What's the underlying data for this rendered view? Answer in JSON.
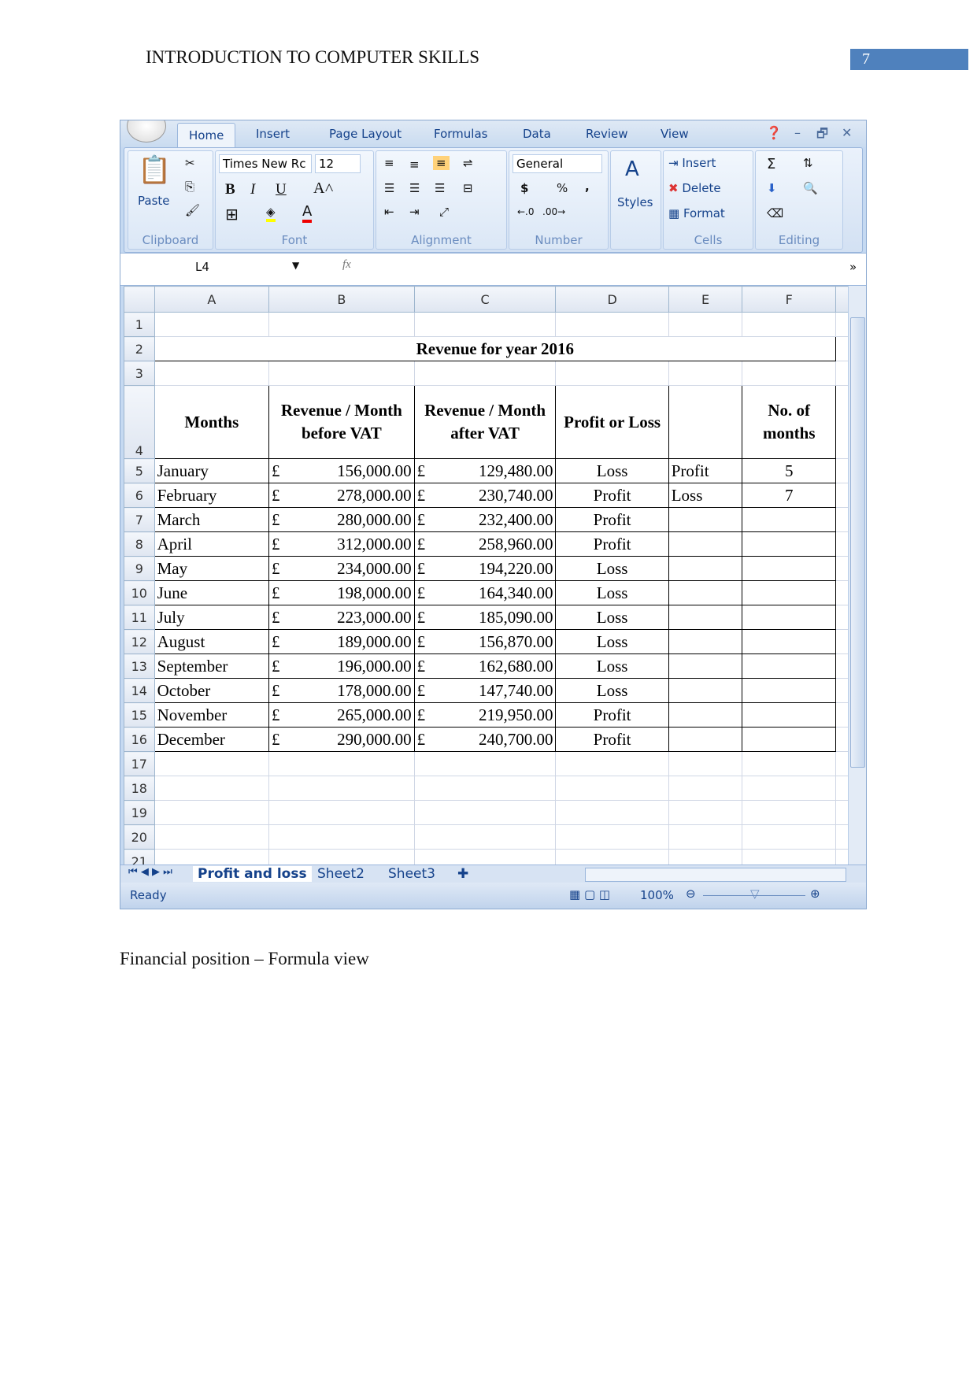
{
  "header": {
    "title": "INTRODUCTION TO COMPUTER SKILLS",
    "page_number": "7",
    "page_number_color": "#4f81bd"
  },
  "ribbon": {
    "tabs": [
      "Home",
      "Insert",
      "Page Layout",
      "Formulas",
      "Data",
      "Review",
      "View"
    ],
    "active_tab": "Home",
    "groups": [
      "Clipboard",
      "Font",
      "Alignment",
      "Number",
      "Styles",
      "Cells",
      "Editing"
    ],
    "paste": "Paste",
    "font_name": "Times New Rc",
    "font_size": "12",
    "number_format": "General",
    "styles": "Styles",
    "insert": "Insert",
    "delete": "Delete",
    "format": "Format",
    "bold": "B",
    "italic": "I",
    "underline": "U",
    "currency": "$",
    "percent": "%",
    "comma": ","
  },
  "formula_bar": {
    "name_box": "L4",
    "fx": "fx",
    "value": ""
  },
  "sheet": {
    "columns": [
      "A",
      "B",
      "C",
      "D",
      "E",
      "F"
    ],
    "title": "Revenue for year 2016",
    "headers": [
      "Months",
      "Revenue / Month before VAT",
      "Revenue / Month after VAT",
      "Profit or Loss",
      "",
      "No. of months"
    ],
    "currency_symbol": "£",
    "rows": [
      {
        "month": "January",
        "before": "156,000.00",
        "after": "129,480.00",
        "pl": "Loss",
        "e": "Profit",
        "f": "5"
      },
      {
        "month": "February",
        "before": "278,000.00",
        "after": "230,740.00",
        "pl": "Profit",
        "e": "Loss",
        "f": "7"
      },
      {
        "month": "March",
        "before": "280,000.00",
        "after": "232,400.00",
        "pl": "Profit",
        "e": "",
        "f": ""
      },
      {
        "month": "April",
        "before": "312,000.00",
        "after": "258,960.00",
        "pl": "Profit",
        "e": "",
        "f": ""
      },
      {
        "month": "May",
        "before": "234,000.00",
        "after": "194,220.00",
        "pl": "Loss",
        "e": "",
        "f": ""
      },
      {
        "month": "June",
        "before": "198,000.00",
        "after": "164,340.00",
        "pl": "Loss",
        "e": "",
        "f": ""
      },
      {
        "month": "July",
        "before": "223,000.00",
        "after": "185,090.00",
        "pl": "Loss",
        "e": "",
        "f": ""
      },
      {
        "month": "August",
        "before": "189,000.00",
        "after": "156,870.00",
        "pl": "Loss",
        "e": "",
        "f": ""
      },
      {
        "month": "September",
        "before": "196,000.00",
        "after": "162,680.00",
        "pl": "Loss",
        "e": "",
        "f": ""
      },
      {
        "month": "October",
        "before": "178,000.00",
        "after": "147,740.00",
        "pl": "Loss",
        "e": "",
        "f": ""
      },
      {
        "month": "November",
        "before": "265,000.00",
        "after": "219,950.00",
        "pl": "Profit",
        "e": "",
        "f": ""
      },
      {
        "month": "December",
        "before": "290,000.00",
        "after": "240,700.00",
        "pl": "Profit",
        "e": "",
        "f": ""
      }
    ],
    "tabs": [
      "Profit and loss",
      "Sheet2",
      "Sheet3"
    ]
  },
  "status": {
    "ready": "Ready",
    "zoom": "100%"
  },
  "caption": "Financial position – Formula view"
}
